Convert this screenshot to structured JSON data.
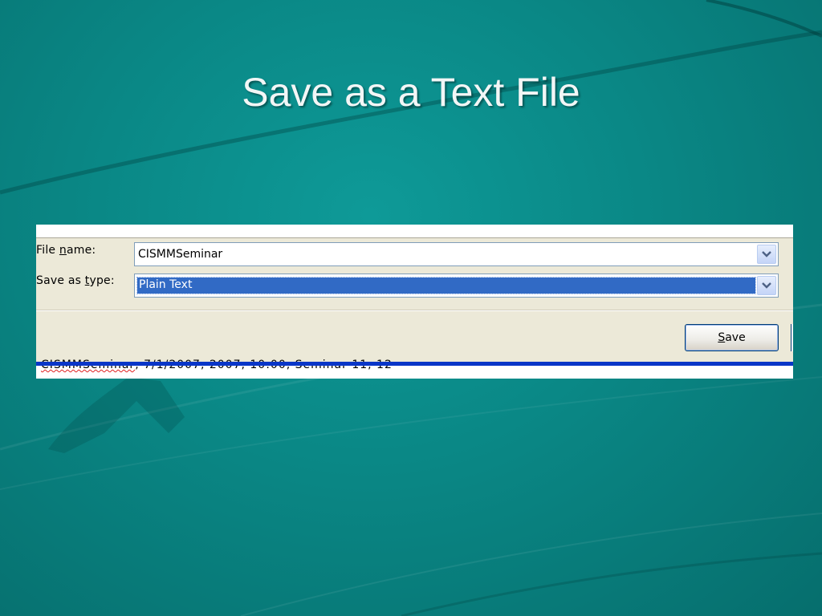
{
  "slide": {
    "title": "Save as a Text File"
  },
  "dialog": {
    "file_name": {
      "label_pre": "File ",
      "label_mn": "n",
      "label_post": "ame:",
      "value": "CISMMSeminar"
    },
    "save_as_type": {
      "label_pre": "Save as ",
      "label_mn": "t",
      "label_post": "ype:",
      "value": "Plain Text"
    },
    "save_button": {
      "mn": "S",
      "rest": "ave"
    },
    "document_text": {
      "squiggled": "CISMMSeminar",
      "rest": ", 7/1/2007, 2007, 10:00, Seminar 11, 12"
    }
  },
  "colors": {
    "background": "#0a8785",
    "dialog": "#ece9d8",
    "selection": "#316ac5",
    "doc_bar": "#0a36c8"
  },
  "icons": {
    "dropdown": "chevron-down-icon"
  }
}
